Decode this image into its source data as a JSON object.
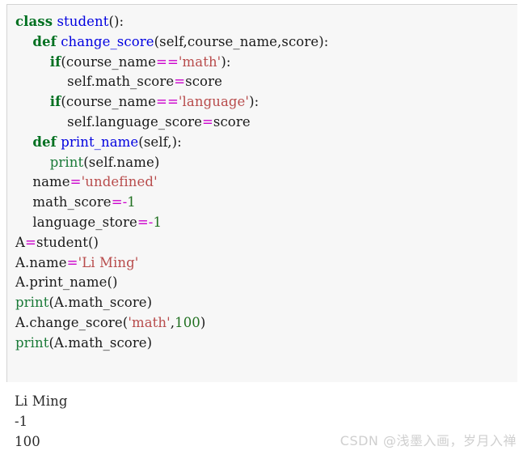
{
  "code_block": {
    "language": "python",
    "background_color": "#f7f7f7",
    "border_color": "#d4d4d4",
    "colors": {
      "keyword": "#007020",
      "function_name": "#0000e0",
      "builtin": "#1a7a38",
      "string": "#b84c4c",
      "operator": "#cc00cc",
      "number": "#207020",
      "plain": "#1a1a1a"
    },
    "lines": [
      {
        "indent": 0,
        "tokens": [
          {
            "text": "class",
            "type": "keyword"
          },
          {
            "text": " ",
            "type": "plain"
          },
          {
            "text": "student",
            "type": "function_name"
          },
          {
            "text": "():",
            "type": "plain"
          }
        ]
      },
      {
        "indent": 4,
        "tokens": [
          {
            "text": "def",
            "type": "keyword"
          },
          {
            "text": " ",
            "type": "plain"
          },
          {
            "text": "change_score",
            "type": "function_name"
          },
          {
            "text": "(self,course_name,score):",
            "type": "plain"
          }
        ]
      },
      {
        "indent": 8,
        "tokens": [
          {
            "text": "if",
            "type": "keyword"
          },
          {
            "text": "(course_name",
            "type": "plain"
          },
          {
            "text": "==",
            "type": "operator"
          },
          {
            "text": "'math'",
            "type": "string"
          },
          {
            "text": "):",
            "type": "plain"
          }
        ]
      },
      {
        "indent": 12,
        "tokens": [
          {
            "text": "self.math_score",
            "type": "plain"
          },
          {
            "text": "=",
            "type": "operator"
          },
          {
            "text": "score",
            "type": "plain"
          }
        ]
      },
      {
        "indent": 8,
        "tokens": [
          {
            "text": "if",
            "type": "keyword"
          },
          {
            "text": "(course_name",
            "type": "plain"
          },
          {
            "text": "==",
            "type": "operator"
          },
          {
            "text": "'language'",
            "type": "string"
          },
          {
            "text": "):",
            "type": "plain"
          }
        ]
      },
      {
        "indent": 12,
        "tokens": [
          {
            "text": "self.language_score",
            "type": "plain"
          },
          {
            "text": "=",
            "type": "operator"
          },
          {
            "text": "score",
            "type": "plain"
          }
        ]
      },
      {
        "indent": 4,
        "tokens": [
          {
            "text": "def",
            "type": "keyword"
          },
          {
            "text": " ",
            "type": "plain"
          },
          {
            "text": "print_name",
            "type": "function_name"
          },
          {
            "text": "(self,):",
            "type": "plain"
          }
        ]
      },
      {
        "indent": 8,
        "tokens": [
          {
            "text": "print",
            "type": "builtin"
          },
          {
            "text": "(self.name)",
            "type": "plain"
          }
        ]
      },
      {
        "indent": 4,
        "tokens": [
          {
            "text": "name",
            "type": "plain"
          },
          {
            "text": "=",
            "type": "operator"
          },
          {
            "text": "'undefined'",
            "type": "string"
          }
        ]
      },
      {
        "indent": 4,
        "tokens": [
          {
            "text": "math_score",
            "type": "plain"
          },
          {
            "text": "=-",
            "type": "operator"
          },
          {
            "text": "1",
            "type": "number"
          }
        ]
      },
      {
        "indent": 4,
        "tokens": [
          {
            "text": "language_store",
            "type": "plain"
          },
          {
            "text": "=-",
            "type": "operator"
          },
          {
            "text": "1",
            "type": "number"
          }
        ]
      },
      {
        "indent": 0,
        "tokens": [
          {
            "text": "A",
            "type": "plain"
          },
          {
            "text": "=",
            "type": "operator"
          },
          {
            "text": "student()",
            "type": "plain"
          }
        ]
      },
      {
        "indent": 0,
        "tokens": [
          {
            "text": "A.name",
            "type": "plain"
          },
          {
            "text": "=",
            "type": "operator"
          },
          {
            "text": "'Li Ming'",
            "type": "string"
          }
        ]
      },
      {
        "indent": 0,
        "tokens": [
          {
            "text": "A.print_name()",
            "type": "plain"
          }
        ]
      },
      {
        "indent": 0,
        "tokens": [
          {
            "text": "print",
            "type": "builtin"
          },
          {
            "text": "(A.math_score)",
            "type": "plain"
          }
        ]
      },
      {
        "indent": 0,
        "tokens": [
          {
            "text": "A.change_score(",
            "type": "plain"
          },
          {
            "text": "'math'",
            "type": "string"
          },
          {
            "text": ",",
            "type": "plain"
          },
          {
            "text": "100",
            "type": "number"
          },
          {
            "text": ")",
            "type": "plain"
          }
        ]
      },
      {
        "indent": 0,
        "tokens": [
          {
            "text": "print",
            "type": "builtin"
          },
          {
            "text": "(A.math_score)",
            "type": "plain"
          }
        ]
      }
    ]
  },
  "output_block": {
    "lines": [
      "Li Ming",
      "-1",
      "100"
    ]
  },
  "watermark": {
    "text": "CSDN @浅墨入画，岁月入禅",
    "color": "#cfcfcf"
  }
}
